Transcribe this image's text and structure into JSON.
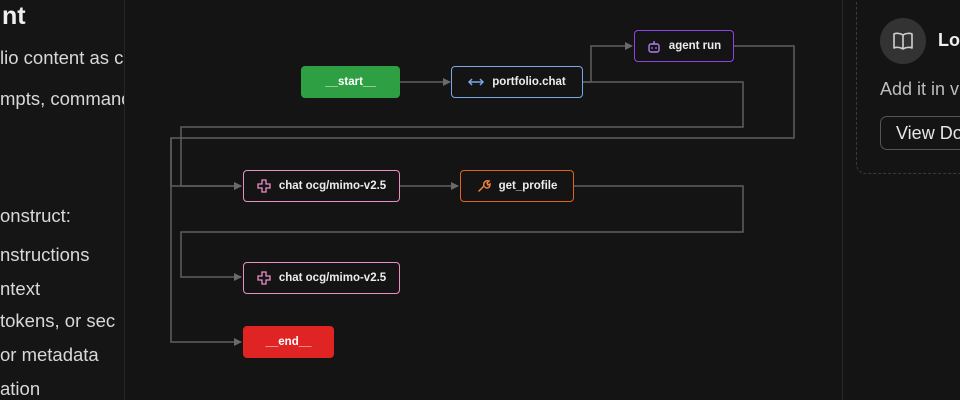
{
  "left_panel": {
    "title": "nt",
    "lines": [
      "lio content as c",
      "mpts, command",
      "onstruct:",
      "nstructions",
      "ntext",
      " tokens, or sec",
      "or metadata",
      "ation"
    ]
  },
  "graph": {
    "nodes": {
      "start": {
        "label": "__start__",
        "color": "#2ea043"
      },
      "portfolio_chat": {
        "label": "portfolio.chat",
        "color": "#7aa7e8",
        "icon": "arrows-left-right-icon"
      },
      "agent_run": {
        "label": "agent run",
        "color": "#8e44e0",
        "icon": "robot-icon"
      },
      "chat_1": {
        "label": "chat ocg/mimo-v2.5",
        "color": "#e98fc2",
        "icon": "model-icon"
      },
      "get_profile": {
        "label": "get_profile",
        "color": "#e0651a",
        "icon": "wrench-icon"
      },
      "chat_2": {
        "label": "chat ocg/mimo-v2.5",
        "color": "#e98fc2",
        "icon": "model-icon"
      },
      "end": {
        "label": "__end__",
        "color": "#e02424"
      }
    }
  },
  "right_panel": {
    "title": "Lo",
    "text": "Add it in v",
    "button": "View Do",
    "icon": "book-icon"
  }
}
